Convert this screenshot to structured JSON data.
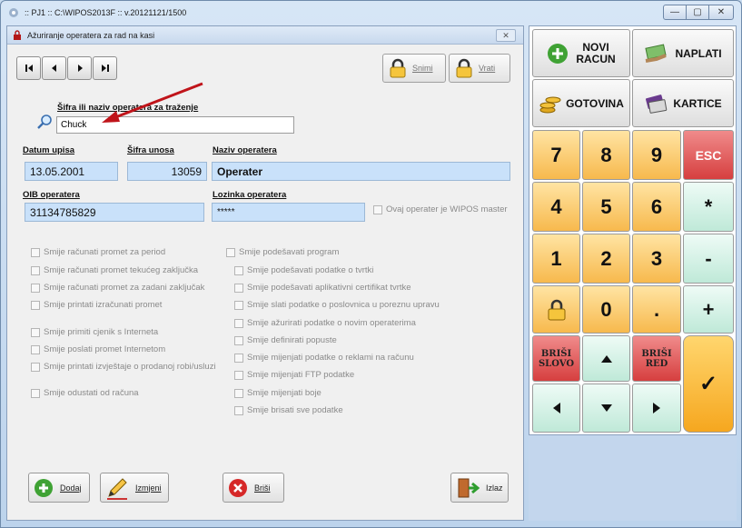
{
  "window": {
    "title": ":: PJ1 :: C:\\WIPOS2013F :: v.20121121/1500",
    "controls": [
      "minimize-icon",
      "maximize-icon",
      "close-icon"
    ]
  },
  "dialog": {
    "title": "Ažuriranje operatera za rad na kasi",
    "toolbar": {
      "save_label": "Snimi",
      "revert_label": "Vrati"
    },
    "search": {
      "label": "Šifra ili naziv operatera za traženje",
      "value": "Chuck"
    },
    "fields": {
      "date_label": "Datum upisa",
      "date_value": "13.05.2001",
      "code_label": "Šifra unosa",
      "code_value": "13059",
      "name_label": "Naziv operatera",
      "name_value": "Operater",
      "oib_label": "OIB operatera",
      "oib_value": "31134785829",
      "password_label": "Lozinka operatera",
      "password_value": "*****",
      "master_label": "Ovaj operater je WIPOS master"
    },
    "permissions_left": [
      "Smije računati promet za period",
      "Smije računati promet tekućeg zaključka",
      "Smije računati promet za zadani zaključak",
      "Smije printati izračunati promet",
      "Smije primiti cjenik s Interneta",
      "Smije poslati promet Internetom",
      "Smije printati izvještaje o prodanoj robi/usluzi",
      "Smije odustati od računa"
    ],
    "permissions_right_header": "Smije podešavati program",
    "permissions_right": [
      "Smije podešavati podatke o tvrtki",
      "Smije podešavati aplikativni certifikat tvrtke",
      "Smije slati podatke o poslovnica u poreznu upravu",
      "Smije ažurirati podatke o novim operaterima",
      "Smije definirati popuste",
      "Smije mijenjati podatke o reklami na računu",
      "Smije mijenjati FTP podatke",
      "Smije mijenjati boje",
      "Smije brisati sve podatke"
    ],
    "buttons": {
      "add": "Dodaj",
      "edit": "Izmjeni",
      "delete": "Briši",
      "exit": "Izlaz"
    }
  },
  "keypad": {
    "new_receipt": "NOVI\nRACUN",
    "pay": "NAPLATI",
    "cash": "GOTOVINA",
    "cards": "KARTICE",
    "digits": [
      "7",
      "8",
      "9",
      "4",
      "5",
      "6",
      "1",
      "2",
      "3",
      "0"
    ],
    "esc": "ESC",
    "multiply": "*",
    "minus": "-",
    "plus": "+",
    "dot": ".",
    "delete_char": "BRIŠI\nSLOVO",
    "delete_row": "BRIŠI\nRED",
    "confirm": "✓",
    "arrows": [
      "up-arrow-icon",
      "left-arrow-icon",
      "down-arrow-icon",
      "right-arrow-icon"
    ]
  },
  "colors": {
    "field_bg": "#c9e1fa",
    "key_orange": "#f7b94d",
    "key_mint": "#bfe9d8",
    "key_red": "#d63f3f",
    "arrow_annotation": "#c0141a"
  }
}
